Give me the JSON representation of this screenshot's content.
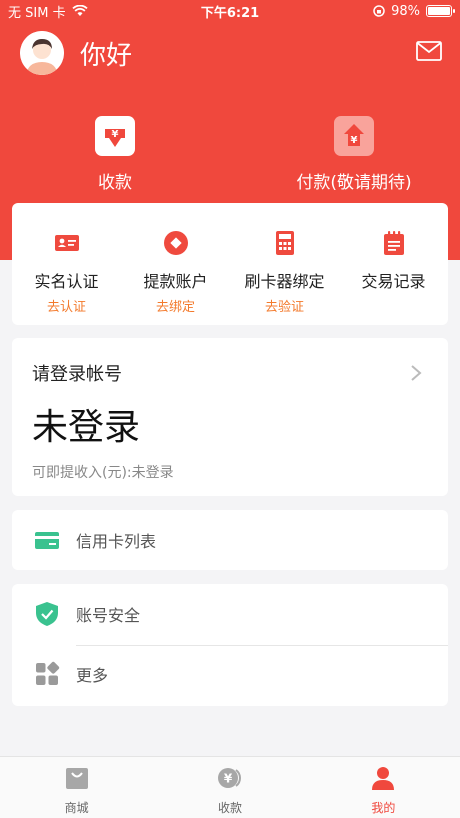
{
  "status_bar": {
    "carrier": "无 SIM 卡",
    "time": "下午6:21",
    "battery": "98%",
    "battery_level": 0.98
  },
  "header": {
    "greeting": "你好",
    "actions": [
      {
        "label": "收款",
        "icon": "receive-yuan-icon"
      },
      {
        "label": "付款(敬请期待)",
        "icon": "pay-yuan-icon"
      }
    ]
  },
  "quick": [
    {
      "label": "实名认证",
      "sub": "去认证",
      "icon": "id-card-icon"
    },
    {
      "label": "提款账户",
      "sub": "去绑定",
      "icon": "coin-icon"
    },
    {
      "label": "刷卡器绑定",
      "sub": "去验证",
      "icon": "calculator-icon"
    },
    {
      "label": "交易记录",
      "sub": "",
      "icon": "notepad-icon"
    }
  ],
  "login": {
    "title": "请登录帐号",
    "status": "未登录",
    "sub": "可即提收入(元):未登录"
  },
  "menu": {
    "credit": "信用卡列表",
    "security": "账号安全",
    "more": "更多"
  },
  "tabs": [
    {
      "label": "商城",
      "icon": "bag-icon",
      "active": false
    },
    {
      "label": "收款",
      "icon": "yuan-coin-icon",
      "active": false
    },
    {
      "label": "我的",
      "icon": "person-icon",
      "active": true
    }
  ],
  "colors": {
    "primary": "#f0483d",
    "accent_orange": "#f37a2c",
    "green": "#3ac28f"
  }
}
